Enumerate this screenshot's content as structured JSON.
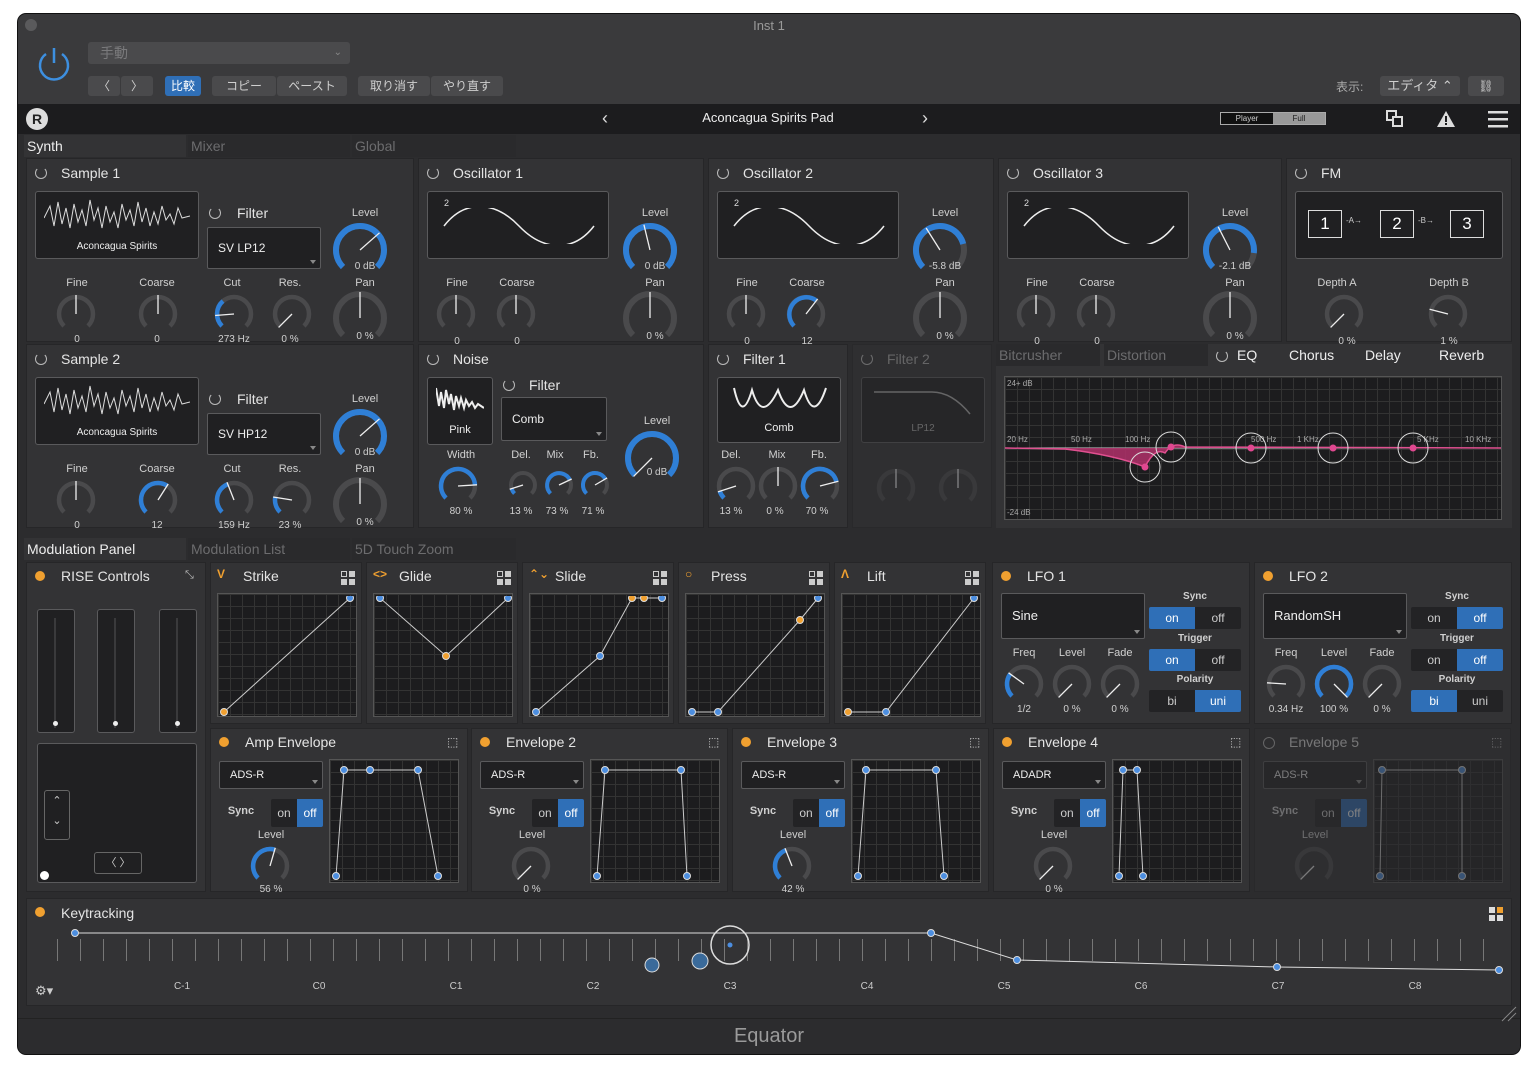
{
  "window": {
    "title": "Inst 1",
    "footer": "Equator"
  },
  "header": {
    "preset": "手動",
    "compare": "比較",
    "copy": "コピー",
    "paste": "ペースト",
    "undo": "取り消す",
    "redo": "やり直す",
    "view_label": "表示:",
    "view_value": "エディタ"
  },
  "toolbar": {
    "preset_name": "Aconcagua Spirits Pad",
    "player": "Player",
    "full": "Full"
  },
  "tabs": {
    "synth": "Synth",
    "mixer": "Mixer",
    "global": "Global",
    "mod_panel": "Modulation Panel",
    "mod_list": "Modulation List",
    "touch": "5D Touch Zoom"
  },
  "sample1": {
    "title": "Sample 1",
    "sample": "Aconcagua Spirits",
    "fine": "Fine",
    "coarse": "Coarse",
    "fine_v": "0",
    "coarse_v": "0",
    "filter": "Filter",
    "filter_type": "SV LP12",
    "cut": "Cut",
    "res": "Res.",
    "cut_v": "273 Hz",
    "res_v": "0 %",
    "level": "Level",
    "level_v": "0 dB",
    "pan": "Pan",
    "pan_v": "0 %"
  },
  "sample2": {
    "title": "Sample 2",
    "sample": "Aconcagua Spirits",
    "fine": "Fine",
    "coarse": "Coarse",
    "fine_v": "0",
    "coarse_v": "12",
    "filter": "Filter",
    "filter_type": "SV HP12",
    "cut": "Cut",
    "res": "Res.",
    "cut_v": "159 Hz",
    "res_v": "23 %",
    "level": "Level",
    "level_v": "0 dB",
    "pan": "Pan",
    "pan_v": "0 %"
  },
  "osc": [
    {
      "title": "Oscillator 1",
      "num": "2",
      "fine": "Fine",
      "coarse": "Coarse",
      "fine_v": "0",
      "coarse_v": "0",
      "level": "Level",
      "level_v": "0 dB",
      "pan": "Pan",
      "pan_v": "0 %"
    },
    {
      "title": "Oscillator 2",
      "num": "2",
      "fine": "Fine",
      "coarse": "Coarse",
      "fine_v": "0",
      "coarse_v": "12",
      "level": "Level",
      "level_v": "-5.8 dB",
      "pan": "Pan",
      "pan_v": "0 %"
    },
    {
      "title": "Oscillator 3",
      "num": "2",
      "fine": "Fine",
      "coarse": "Coarse",
      "fine_v": "0",
      "coarse_v": "0",
      "level": "Level",
      "level_v": "-2.1 dB",
      "pan": "Pan",
      "pan_v": "0 %"
    }
  ],
  "fm": {
    "title": "FM",
    "n1": "1",
    "n2": "2",
    "n3": "3",
    "a": "A",
    "b": "B",
    "depth_a": "Depth A",
    "depth_b": "Depth B",
    "depth_a_v": "0 %",
    "depth_b_v": "1 %"
  },
  "noise": {
    "title": "Noise",
    "color": "Pink",
    "width": "Width",
    "width_v": "80 %",
    "filter": "Filter",
    "filter_type": "Comb",
    "del": "Del.",
    "mix": "Mix",
    "fb": "Fb.",
    "del_v": "13 %",
    "mix_v": "73 %",
    "fb_v": "71 %",
    "level": "Level",
    "level_v": "0 dB"
  },
  "filter1": {
    "title": "Filter 1",
    "type": "Comb",
    "del": "Del.",
    "mix": "Mix",
    "fb": "Fb.",
    "del_v": "13 %",
    "mix_v": "0 %",
    "fb_v": "70 %"
  },
  "filter2": {
    "title": "Filter 2",
    "type": "LP12"
  },
  "fx": {
    "bitcrusher": "Bitcrusher",
    "distortion": "Distortion",
    "eq": "EQ",
    "chorus": "Chorus",
    "delay": "Delay",
    "reverb": "Reverb",
    "db_top": "24+ dB",
    "db_bot": "-24 dB",
    "freqs": [
      "20 Hz",
      "50 Hz",
      "100 Hz",
      "500 Hz",
      "1 KHz",
      "5 KHz",
      "10 KHz"
    ]
  },
  "mod": {
    "rise": "RISE Controls",
    "strike": "Strike",
    "glide": "Glide",
    "slide": "Slide",
    "press": "Press",
    "lift": "Lift"
  },
  "lfo1": {
    "title": "LFO 1",
    "shape": "Sine",
    "sync": "Sync",
    "trigger": "Trigger",
    "polarity": "Polarity",
    "on": "on",
    "off": "off",
    "bi": "bi",
    "uni": "uni",
    "freq": "Freq",
    "level": "Level",
    "fade": "Fade",
    "freq_v": "1/2",
    "level_v": "0 %",
    "fade_v": "0 %"
  },
  "lfo2": {
    "title": "LFO 2",
    "shape": "RandomSH",
    "sync": "Sync",
    "trigger": "Trigger",
    "polarity": "Polarity",
    "on": "on",
    "off": "off",
    "bi": "bi",
    "uni": "uni",
    "freq": "Freq",
    "level": "Level",
    "fade": "Fade",
    "freq_v": "0.34 Hz",
    "level_v": "100 %",
    "fade_v": "0 %"
  },
  "envs": [
    {
      "title": "Amp Envelope",
      "type": "ADS-R",
      "sync": "Sync",
      "on": "on",
      "off": "off",
      "level": "Level",
      "level_v": "56 %"
    },
    {
      "title": "Envelope 2",
      "type": "ADS-R",
      "sync": "Sync",
      "on": "on",
      "off": "off",
      "level": "Level",
      "level_v": "0 %"
    },
    {
      "title": "Envelope 3",
      "type": "ADS-R",
      "sync": "Sync",
      "on": "on",
      "off": "off",
      "level": "Level",
      "level_v": "42 %"
    },
    {
      "title": "Envelope 4",
      "type": "ADADR",
      "sync": "Sync",
      "on": "on",
      "off": "off",
      "level": "Level",
      "level_v": "0 %"
    },
    {
      "title": "Envelope 5",
      "type": "ADS-R",
      "sync": "Sync",
      "on": "on",
      "off": "off",
      "level": "Level",
      "level_v": ""
    }
  ],
  "keytracking": {
    "title": "Keytracking",
    "notes": [
      "C-1",
      "C0",
      "C1",
      "C2",
      "C3",
      "C4",
      "C5",
      "C6",
      "C7",
      "C8"
    ]
  }
}
